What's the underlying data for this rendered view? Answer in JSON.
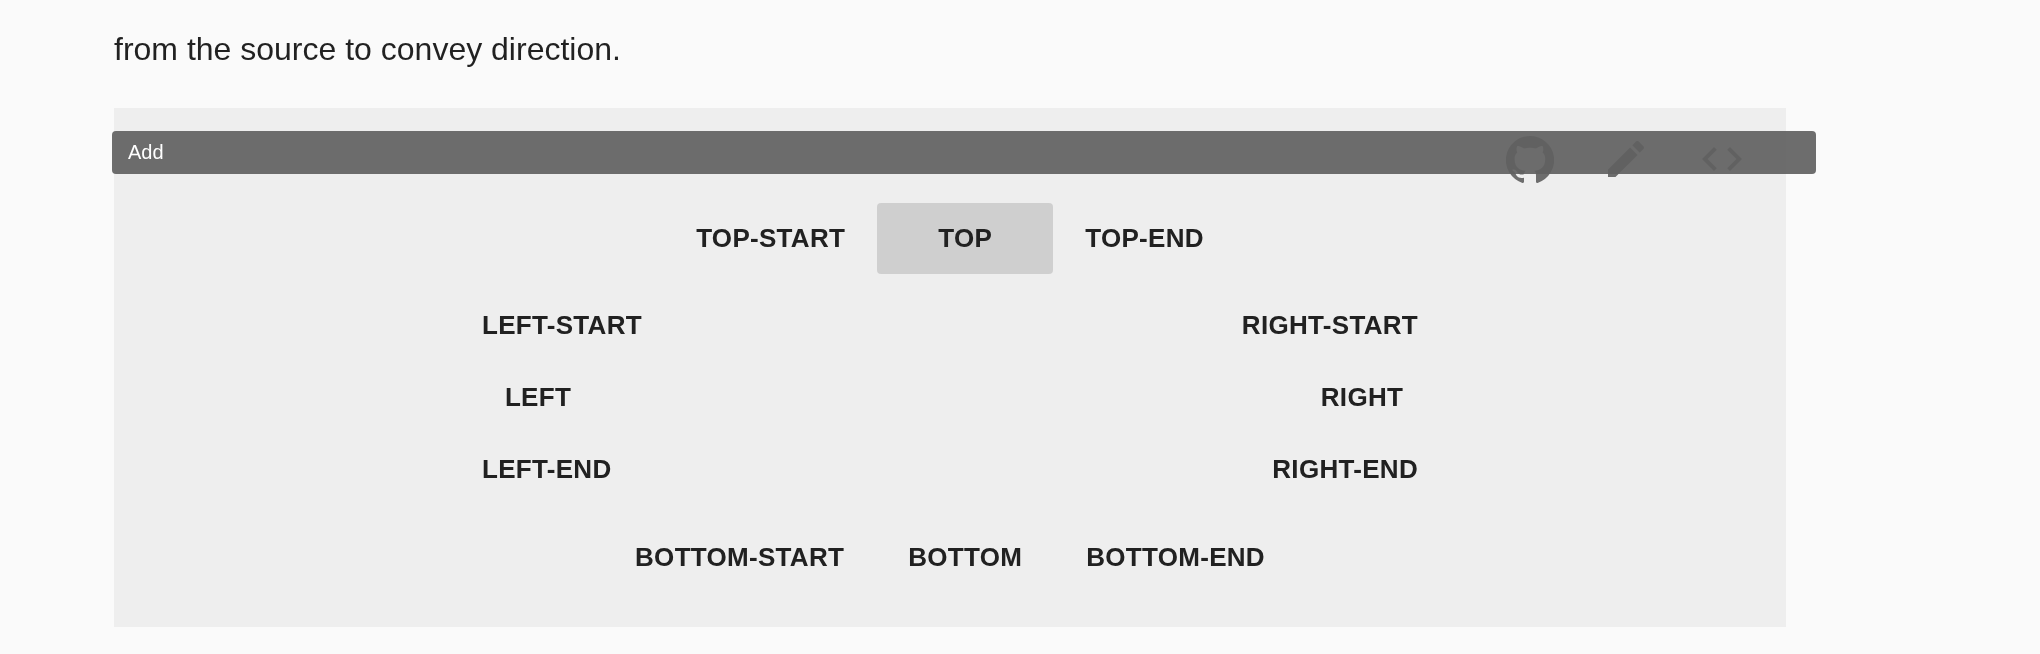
{
  "intro": {
    "text": "from the source to convey direction."
  },
  "demo": {
    "tooltip": "Add",
    "top_row": [
      {
        "label": "TOP-START",
        "hovered": false
      },
      {
        "label": "TOP",
        "hovered": true
      },
      {
        "label": "TOP-END",
        "hovered": false
      }
    ],
    "left_column": [
      {
        "label": "LEFT-START",
        "hovered": false
      },
      {
        "label": "LEFT",
        "hovered": false
      },
      {
        "label": "LEFT-END",
        "hovered": false
      }
    ],
    "right_column": [
      {
        "label": "RIGHT-START",
        "hovered": false
      },
      {
        "label": "RIGHT",
        "hovered": false
      },
      {
        "label": "RIGHT-END",
        "hovered": false
      }
    ],
    "bottom_row": [
      {
        "label": "BOTTOM-START",
        "hovered": false
      },
      {
        "label": "BOTTOM",
        "hovered": false
      },
      {
        "label": "BOTTOM-END",
        "hovered": false
      }
    ]
  }
}
